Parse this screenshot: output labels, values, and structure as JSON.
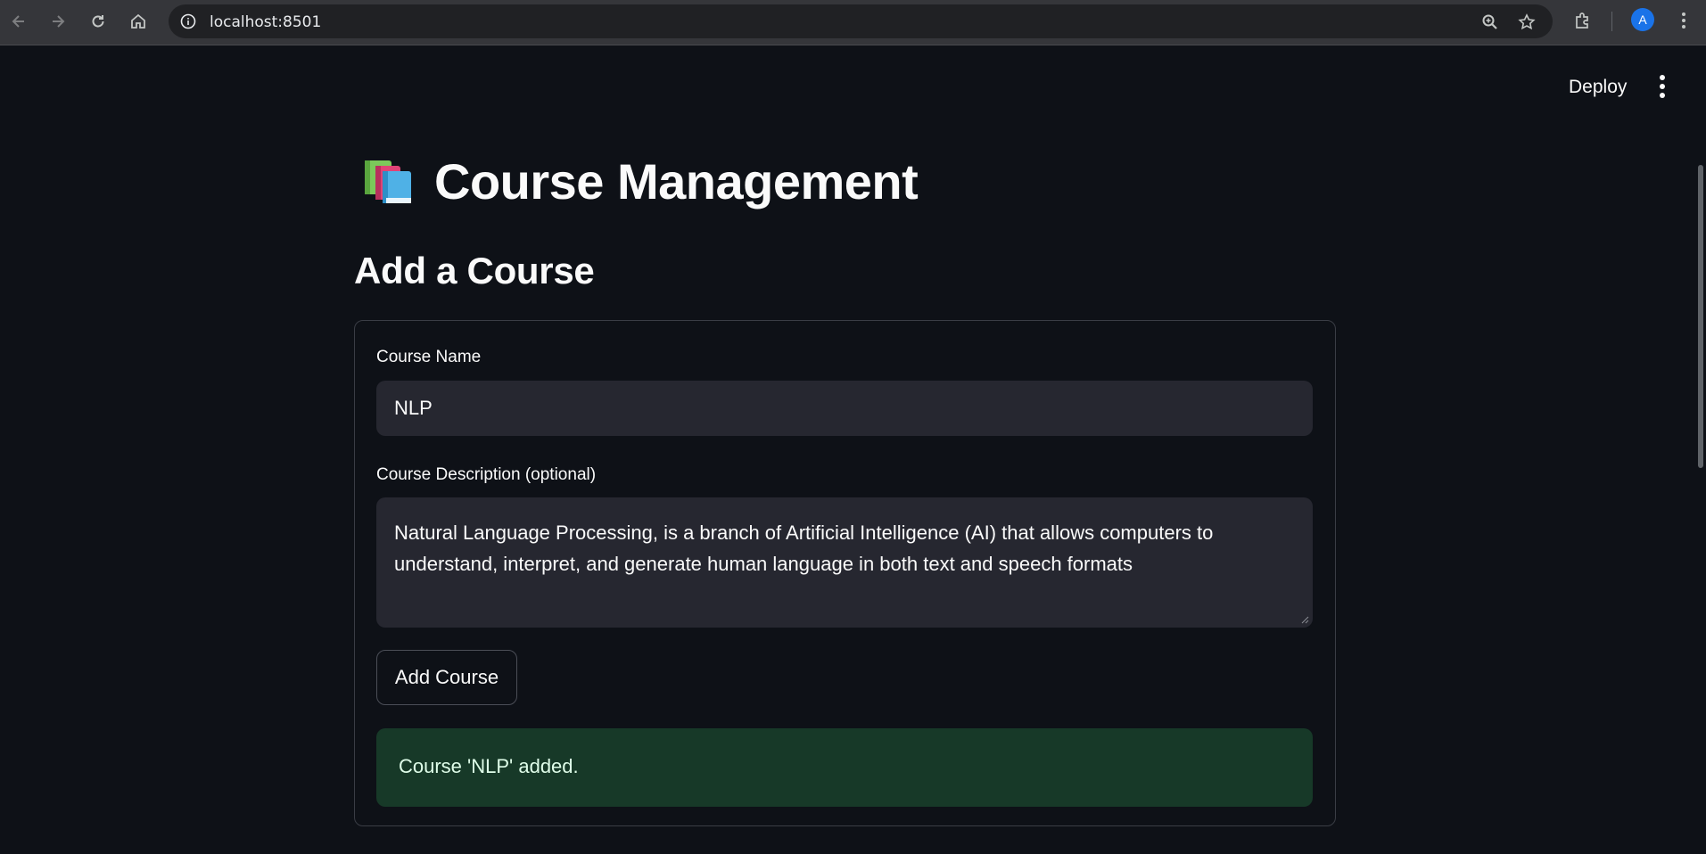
{
  "browser": {
    "url": "localhost:8501",
    "avatar_letter": "A"
  },
  "header": {
    "deploy_label": "Deploy"
  },
  "main": {
    "title_icon": "books-emoji-icon",
    "title": "Course Management",
    "subheader": "Add a Course",
    "form": {
      "course_name_label": "Course Name",
      "course_name_value": "NLP",
      "description_label": "Course Description (optional)",
      "description_value": "Natural Language Processing, is a branch of Artificial Intelligence (AI) that allows computers to understand, interpret, and generate human language in both text and speech formats",
      "submit_label": "Add Course",
      "success_message": "Course 'NLP' added."
    }
  },
  "colors": {
    "background": "#0e1117",
    "input_bg": "#262730",
    "success_bg": "#173928",
    "success_text": "#dffde9"
  }
}
